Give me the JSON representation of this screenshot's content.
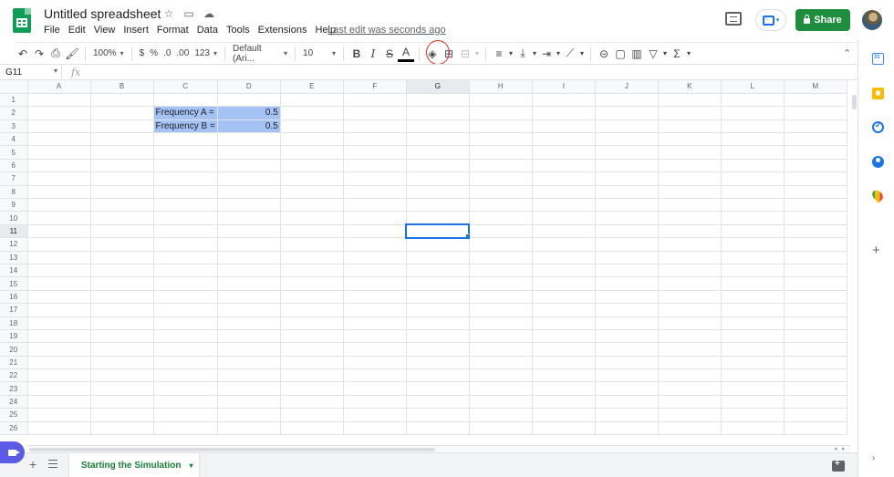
{
  "header": {
    "title": "Untitled spreadsheet",
    "menus": [
      "File",
      "Edit",
      "View",
      "Insert",
      "Format",
      "Data",
      "Tools",
      "Extensions",
      "Help"
    ],
    "last_edit": "Last edit was seconds ago",
    "share_label": "Share"
  },
  "toolbar": {
    "zoom": "100%",
    "currency": "$",
    "percent": "%",
    "dec_decrease": ".0",
    "dec_increase": ".00",
    "more_formats": "123",
    "font": "Default (Ari...",
    "font_size": "10",
    "bold": "B",
    "italic": "I",
    "strike": "S",
    "text_color": "A"
  },
  "formula_bar": {
    "cell_ref": "G11",
    "fx": "fx",
    "value": ""
  },
  "grid": {
    "columns": [
      "A",
      "B",
      "C",
      "D",
      "E",
      "F",
      "G",
      "H",
      "I",
      "J",
      "K",
      "L",
      "M"
    ],
    "rows": [
      "1",
      "2",
      "3",
      "4",
      "5",
      "6",
      "7",
      "8",
      "9",
      "10",
      "11",
      "12",
      "13",
      "14",
      "15",
      "16",
      "17",
      "18",
      "19",
      "20",
      "21",
      "22",
      "23",
      "24",
      "25",
      "26"
    ],
    "cells": {
      "C2": "Frequency A =",
      "D2": "0.5",
      "C3": "Frequency B =",
      "D3": "0.5"
    },
    "highlight_color": "#a4c2f4",
    "active_cell": "G11"
  },
  "sheets": {
    "active": "Starting the Simulation"
  },
  "colors": {
    "brand_green": "#1e8e3e",
    "selection_blue": "#1a73e8",
    "highlight_red": "#d93025"
  }
}
